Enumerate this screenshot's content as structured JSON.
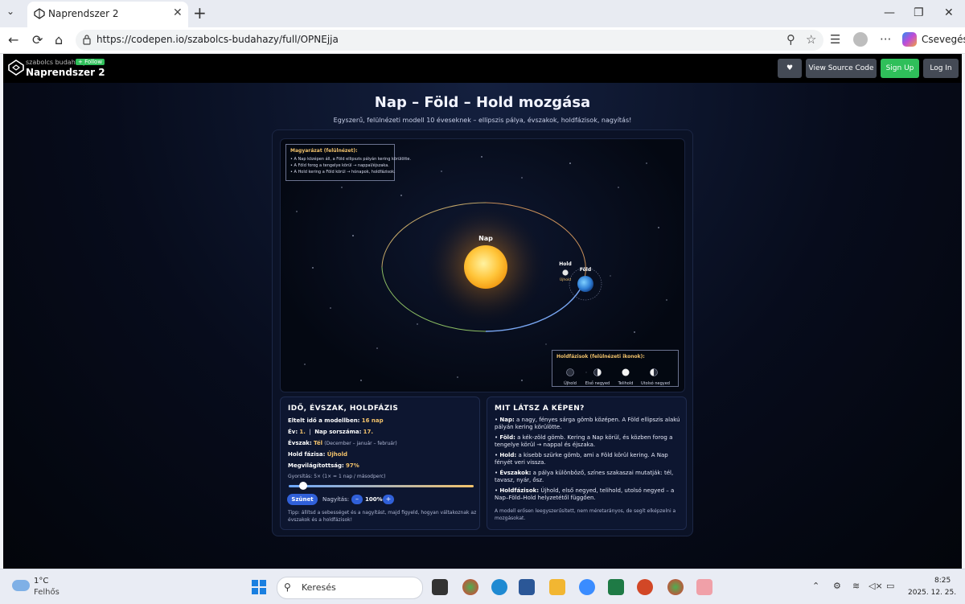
{
  "browser": {
    "tab_title": "Naprendszer 2",
    "url": "https://codepen.io/szabolcs-budahazy/full/OPNEjja",
    "profile_label": "Csevegés"
  },
  "codepen": {
    "user": "szabolcs budahazy",
    "follow": "+ Follow",
    "pen_title": "Naprendszer 2",
    "view_source": "View Source Code",
    "sign_up": "Sign Up",
    "log_in": "Log In"
  },
  "page": {
    "title": "Nap – Föld – Hold mozgása",
    "subtitle": "Egyszerű, felülnézeti modell 10 éveseknek – ellipszis pálya, évszakok, holdfázisok, nagyítás!"
  },
  "scene": {
    "legend_title": "Magyarázat (felülnézet):",
    "legend_lines": [
      "• A Nap középen áll, a Föld ellipszis pályán kering körülötte.",
      "• A Föld forog a tengelye körül → nappal/éjszaka.",
      "• A Hold kering a Föld körül → hónapok, holdfázisok."
    ],
    "sun_label": "Nap",
    "earth_label": "Föld",
    "moon_label": "Hold",
    "moon_phase_label": "Újhold",
    "phases_title": "Holdfázisok (felülnézeti ikonok):",
    "phases": [
      "Újhold",
      "Első negyed",
      "Telihold",
      "Utolsó negyed"
    ],
    "colors": {
      "sun": "#ffb52a",
      "orbit_warm": "#d8b870",
      "orbit_cool": "#7fb0ff",
      "earth": "#2f7fd6"
    }
  },
  "status": {
    "title": "IDŐ, ÉVSZAK, HOLDFÁZIS",
    "elapsed_label": "Eltelt idő a modellben:",
    "elapsed_value": "16 nap",
    "year_label": "Év:",
    "year_value": "1.",
    "separator": "|",
    "day_label": "Nap sorszáma:",
    "day_value": "17.",
    "season_label": "Évszak:",
    "season_value": "Tél",
    "season_months": "(December – január – február)",
    "moon_label": "Hold fázisa:",
    "moon_value": "Újhold",
    "light_label": "Megvilágítottság:",
    "light_value": "97%",
    "speed_text": "Gyorsítás: 5× (1× = 1 nap / másodperc)",
    "speed_level": 0.08,
    "pause_button": "Szünet",
    "zoom_label": "Nagyítás:",
    "zoom_minus": "–",
    "zoom_value": "100%",
    "zoom_plus": "+",
    "tip": "Tipp: állítsd a sebességet és a nagyítást, majd figyeld, hogyan váltakoznak az évszakok és a holdfázisok!"
  },
  "info": {
    "title": "MIT LÁTSZ A KÉPEN?",
    "items": [
      {
        "term": "Nap:",
        "text": " a nagy, fényes sárga gömb középen. A Föld ellipszis alakú pályán kering körülötte."
      },
      {
        "term": "Föld:",
        "text": " a kék-zöld gömb. Kering a Nap körül, és közben forog a tengelye körül → nappal és éjszaka."
      },
      {
        "term": "Hold:",
        "text": " a kisebb szürke gömb, ami a Föld körül kering. A Nap fényét veri vissza."
      },
      {
        "term": "Évszakok:",
        "text": " a pálya különböző, színes szakaszai mutatják: tél, tavasz, nyár, ősz."
      },
      {
        "term": "Holdfázisok:",
        "text": " Újhold, első negyed, telihold, utolsó negyed – a Nap–Föld–Hold helyzetétől függően."
      }
    ],
    "note": "A modell erősen leegyszerűsített, nem méretarányos, de segít elképzelni a mozgásokat."
  },
  "taskbar": {
    "temp": "1°C",
    "weather": "Felhős",
    "search": "Keresés",
    "time": "8:25",
    "date": "2025. 12. 25."
  }
}
